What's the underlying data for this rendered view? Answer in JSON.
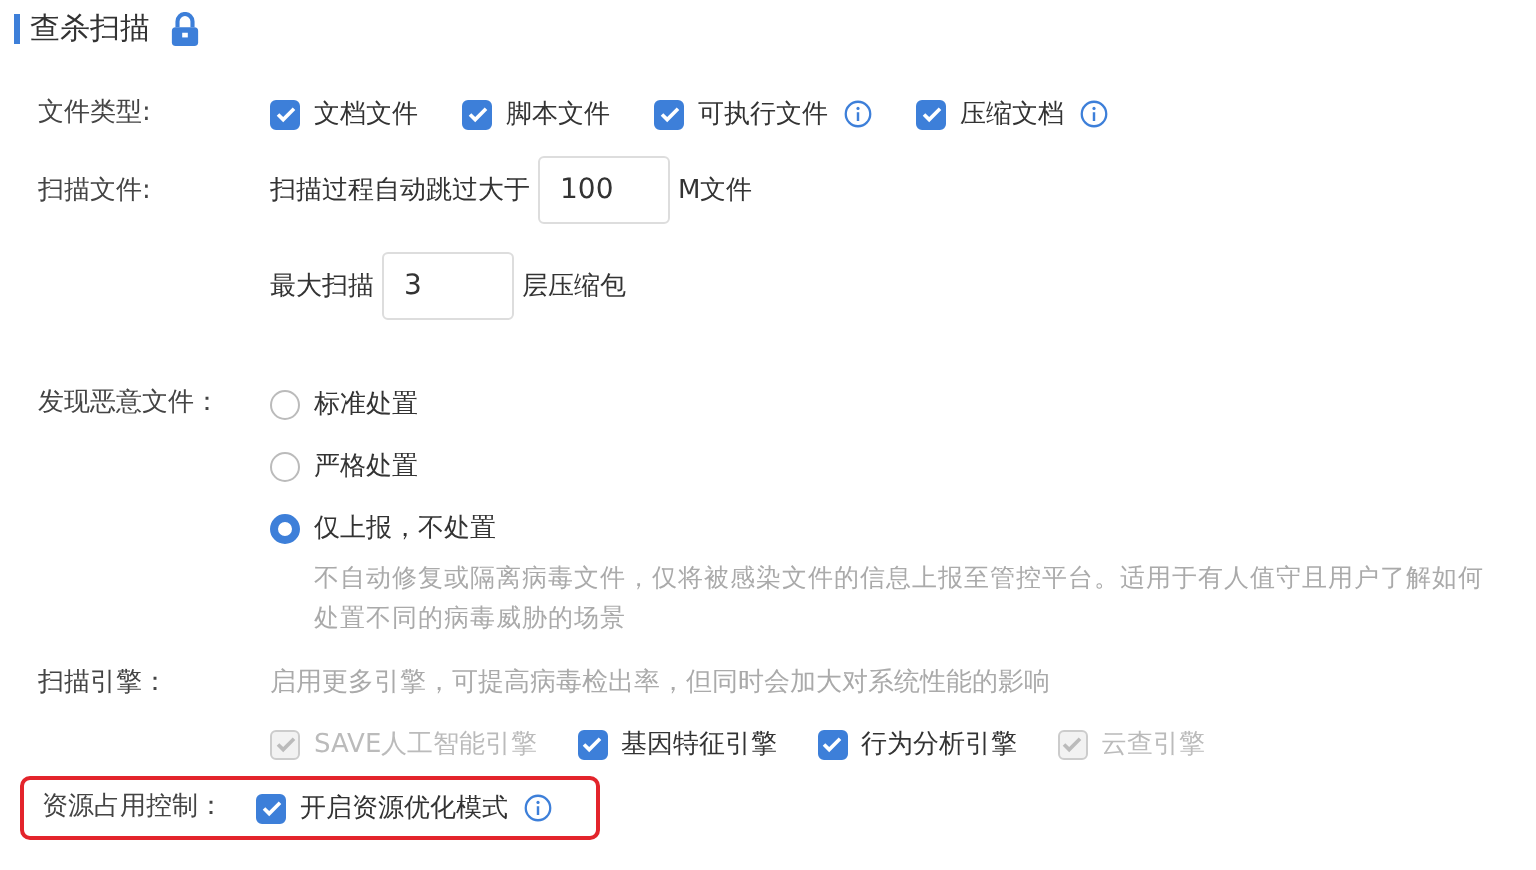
{
  "title": "查杀扫描",
  "locked": true,
  "file_types": {
    "label": "文件类型:",
    "options": [
      {
        "label": "文档文件",
        "checked": true,
        "info": false
      },
      {
        "label": "脚本文件",
        "checked": true,
        "info": false
      },
      {
        "label": "可执行文件",
        "checked": true,
        "info": true
      },
      {
        "label": "压缩文档",
        "checked": true,
        "info": true
      }
    ]
  },
  "scan_files": {
    "label": "扫描文件:",
    "size_prefix": "扫描过程自动跳过大于",
    "size_value": "100",
    "size_suffix": "M文件",
    "depth_prefix": "最大扫描",
    "depth_value": "3",
    "depth_suffix": "层压缩包"
  },
  "malicious": {
    "label": "发现恶意文件：",
    "options": [
      {
        "label": "标准处置",
        "selected": false
      },
      {
        "label": "严格处置",
        "selected": false
      },
      {
        "label": "仅上报，不处置",
        "selected": true,
        "description": "不自动修复或隔离病毒文件，仅将被感染文件的信息上报至管控平台。适用于有人值守且用户了解如何处置不同的病毒威胁的场景"
      }
    ]
  },
  "engines": {
    "label": "扫描引擎：",
    "hint": "启用更多引擎，可提高病毒检出率，但同时会加大对系统性能的影响",
    "options": [
      {
        "label": "SAVE人工智能引擎",
        "checked": true,
        "disabled": true
      },
      {
        "label": "基因特征引擎",
        "checked": true,
        "disabled": false
      },
      {
        "label": "行为分析引擎",
        "checked": true,
        "disabled": false
      },
      {
        "label": "云查引擎",
        "checked": true,
        "disabled": true
      }
    ]
  },
  "resource": {
    "label": "资源占用控制：",
    "highlighted": true,
    "option": {
      "label": "开启资源优化模式",
      "checked": true,
      "info": true
    }
  }
}
